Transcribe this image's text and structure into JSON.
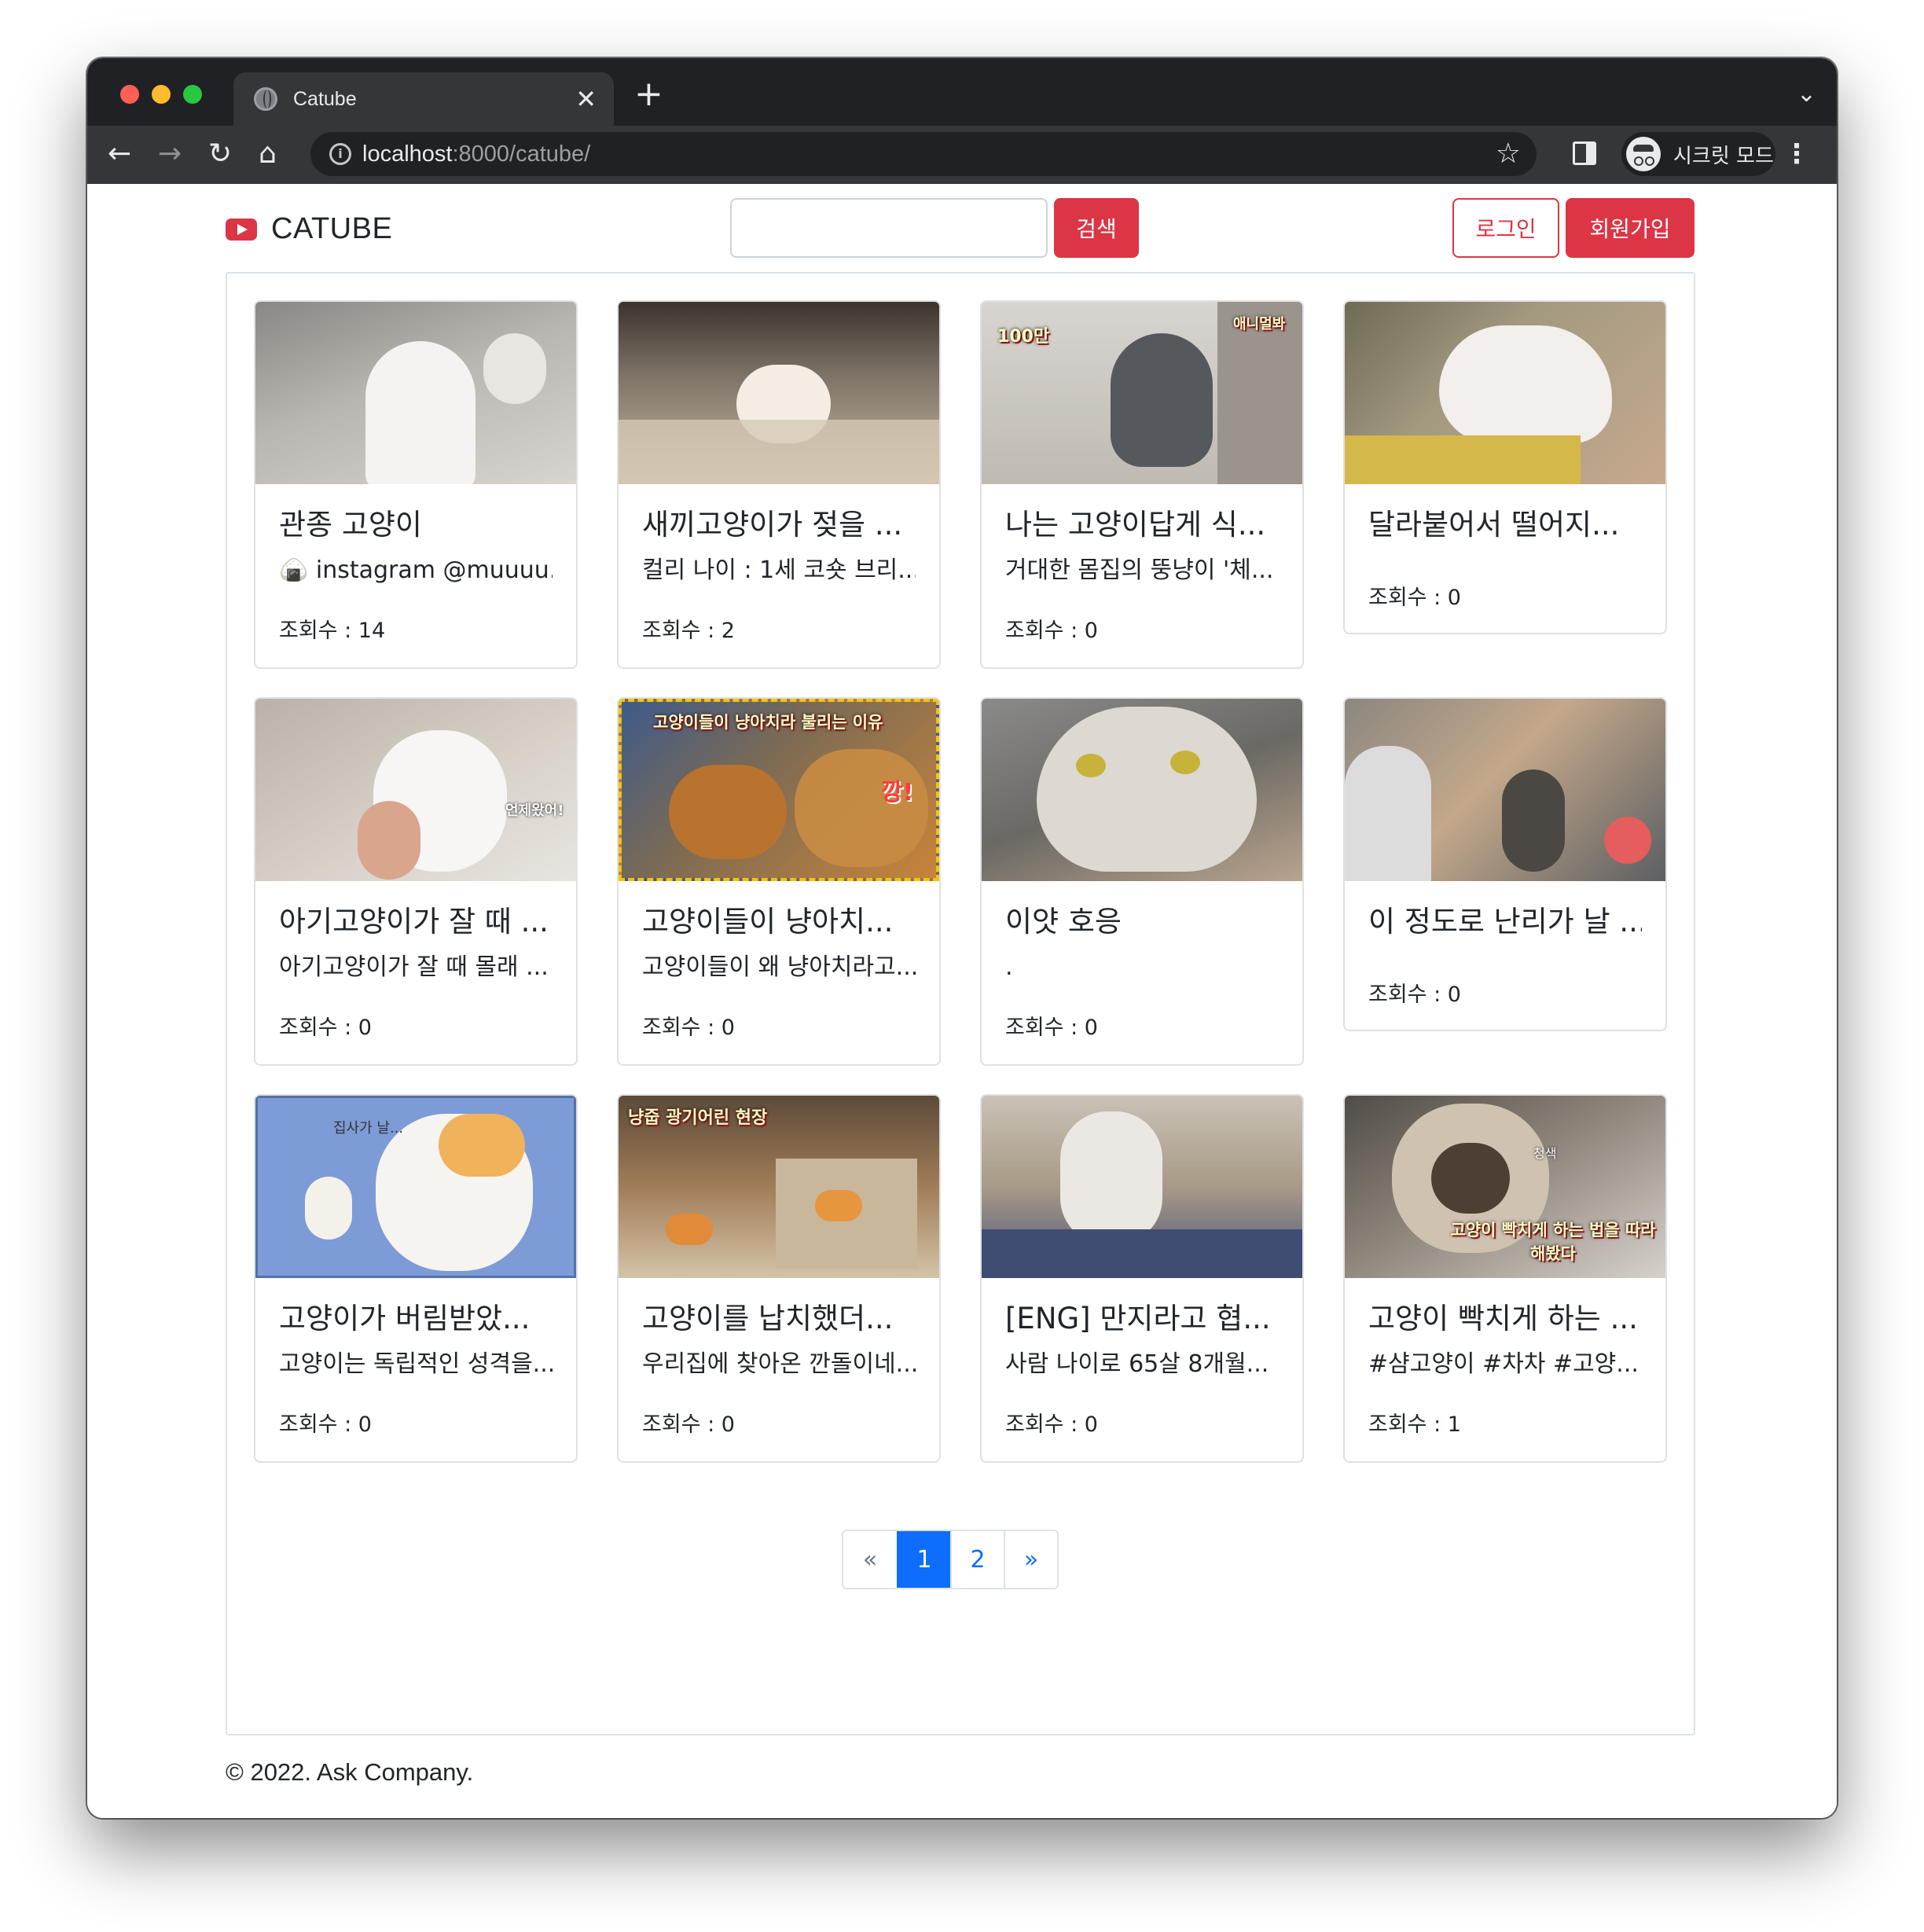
{
  "browser": {
    "tab_title": "Catube",
    "tab_close": "✕",
    "new_tab": "+",
    "tab_menu": "⌄",
    "url_host": "localhost",
    "url_rest": ":8000/catube/",
    "incognito_label": "시크릿 모드",
    "icons": [
      "globe-icon",
      "back-arrow-icon",
      "forward-arrow-icon",
      "reload-icon",
      "home-icon",
      "info-icon",
      "star-icon",
      "side-panel-icon",
      "incognito-icon",
      "more-vert-icon"
    ]
  },
  "header": {
    "brand": "CATUBE",
    "search_button": "검색",
    "login_button": "로그인",
    "signup_button": "회원가입",
    "brand_color": "#dc3545"
  },
  "videos": [
    {
      "title": "관종 고양이",
      "desc": "🍙 instagram @muuuu...",
      "views": "조회수 : 14"
    },
    {
      "title": "새끼고양이가 젖을 ...",
      "desc": "컬리 나이 : 1세 코숏 브리...",
      "views": "조회수 : 2"
    },
    {
      "title": "나는 고양이답게 식...",
      "desc": "거대한 몸집의 뚱냥이 '체...",
      "views": "조회수 : 0",
      "caption_a": "100만",
      "caption_b": "애니멀봐"
    },
    {
      "title": "달라붙어서 떨어지...",
      "desc": "",
      "views": "조회수 : 0"
    },
    {
      "title": "아기고양이가 잘 때 ...",
      "desc": "아기고양이가 잘 때 몰래 ...",
      "views": "조회수 : 0",
      "caption_a": "언제왔어!"
    },
    {
      "title": "고양이들이 냥아치...",
      "desc": "고양이들이 왜 냥아치라고...",
      "views": "조회수 : 0",
      "caption_a": "고양이들이 냥아치라 불리는 이유",
      "caption_b": "깡!"
    },
    {
      "title": "이얏 호응",
      "desc": ".",
      "views": "조회수 : 0"
    },
    {
      "title": "이 정도로 난리가 날 ...",
      "desc": "",
      "views": "조회수 : 0"
    },
    {
      "title": "고양이가 버림받았...",
      "desc": "고양이는 독립적인 성격을...",
      "views": "조회수 : 0",
      "caption_a": "집사가 날..."
    },
    {
      "title": "고양이를 납치했더...",
      "desc": "우리집에 찾아온 깐돌이네...",
      "views": "조회수 : 0",
      "caption_a": "냥줍 광기어린 현장"
    },
    {
      "title": "[ENG] 만지라고 협...",
      "desc": "사람 나이로 65살 8개월...",
      "views": "조회수 : 0"
    },
    {
      "title": "고양이 빡치게 하는 ...",
      "desc": "#샴고양이 #차차 #고양...",
      "views": "조회수 : 1",
      "caption_a": "고양이 빡치게 하는 법을 따라해봤다",
      "caption_b": "청색"
    }
  ],
  "pagination": {
    "prev": "«",
    "pages": [
      "1",
      "2"
    ],
    "active": "1",
    "next": "»"
  },
  "footer": {
    "text": "© 2022. Ask Company."
  }
}
